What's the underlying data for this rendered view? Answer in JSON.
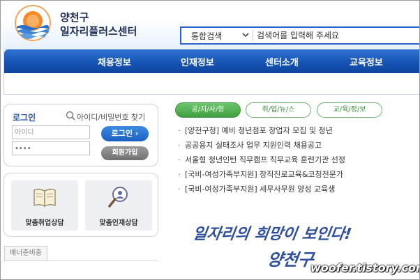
{
  "org": {
    "name_line1": "양천구",
    "name_line2": "일자리플러스센터",
    "logo_icon": "sun-over-waves-logo"
  },
  "search": {
    "category": "통합검색",
    "placeholder": "검색어를 입력해 주세요"
  },
  "nav": {
    "items": [
      "채용정보",
      "인재정보",
      "센터소개",
      "교육정보"
    ]
  },
  "login": {
    "title": "로그인",
    "find_link": "아이디/비밀번호 찾기",
    "id_placeholder": "아이디",
    "pw_value": "••••",
    "login_button": "로그인 ›",
    "join_button": "회원가입"
  },
  "consult": {
    "items": [
      "맞춤취업상담",
      "맞춤인재상담"
    ]
  },
  "banner": {
    "label": "배너준비중"
  },
  "tabs": {
    "items": [
      "공/지/사/항",
      "취/업/뉴/스",
      "교/육/정/보"
    ],
    "active": "공/지/사/항"
  },
  "notices": [
    "[양천구청] 예비 청년점포 창업자 모집 및 청년",
    "공공용지 실태조사 업무 지원인력 채용공고",
    "서울형 청년인턴 직무캠프 직무교육 훈련기관 선정",
    "[국비-여성가족부지원] 창직진로교육&코칭전문가",
    "[국비-여성가족부지원] 세무사무원 양성 교육생"
  ],
  "slogan": {
    "line1": "일자리의 희망이 보인다!",
    "line2": "양천구"
  },
  "watermark": "woofer.tistory.com",
  "colors": {
    "nav_blue": "#1552b1",
    "tab_green": "#3f9f3f",
    "search_border": "#2b64c8",
    "login_title": "#2a55a8"
  }
}
